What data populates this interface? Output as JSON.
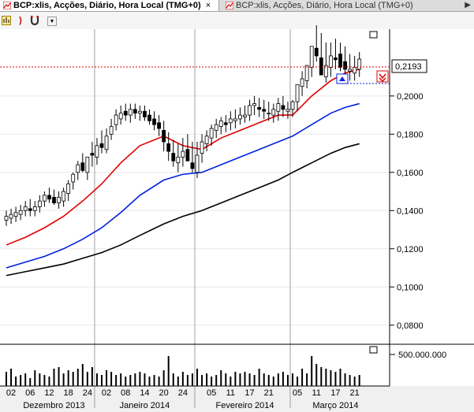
{
  "tabs": [
    {
      "label": "BCP:xlis, Acções, Diário, Hora Local (TMG+0)",
      "close": "×",
      "active": true,
      "icon": "chart-icon"
    },
    {
      "label": "BCP:xlis, Acções, Diário, Hora Local (TMG+0)",
      "active": false,
      "icon": "chart-icon"
    }
  ],
  "toolbar": {
    "icons": [
      "chart-icon",
      "undo-icon",
      "magnet-icon",
      "dropdown-icon"
    ]
  },
  "price_panel": {
    "last_price_label": "0,2193"
  },
  "volume_panel": {
    "scale_label": "500.000.000"
  },
  "colors": {
    "bull": "#ffffff",
    "bear": "#000000",
    "ma_fast": "#e00000",
    "ma_mid": "#0022dd",
    "ma_slow": "#000000",
    "last_price_line": "#e00000",
    "grid": "#a0a0a0"
  },
  "chart_data": [
    {
      "type": "candlestick",
      "title": "BCP:xlis, Acções, Diário, Hora Local (TMG+0)",
      "xlabel": "",
      "ylabel": "",
      "ylim": [
        0.07,
        0.235
      ],
      "y_ticks": [
        "0,2000",
        "0,1800",
        "0,1600",
        "0,1400",
        "0,1200",
        "0,1000",
        "0,0800"
      ],
      "y_tick_values": [
        0.2,
        0.18,
        0.16,
        0.14,
        0.12,
        0.1,
        0.08
      ],
      "x_tick_labels": [
        "02",
        "06",
        "12",
        "18",
        "24",
        "02",
        "08",
        "14",
        "20",
        "24",
        "05",
        "11",
        "17",
        "21",
        "05",
        "11",
        "17",
        "21"
      ],
      "x_tick_index": [
        1,
        5,
        9,
        13,
        17,
        21,
        25,
        29,
        33,
        37,
        43,
        47,
        51,
        55,
        61,
        65,
        69,
        73
      ],
      "month_labels": [
        {
          "label": "Dezembro 2013",
          "index": 10
        },
        {
          "label": "Janeiro 2014",
          "index": 29
        },
        {
          "label": "Fevereiro 2014",
          "index": 50
        },
        {
          "label": "Março 2014",
          "index": 69
        }
      ],
      "month_separators": [
        19,
        40,
        60
      ],
      "grid": true,
      "last_price": 0.2193,
      "series": [
        {
          "type": "ohlc",
          "open": [
            0.135,
            0.136,
            0.137,
            0.138,
            0.14,
            0.141,
            0.14,
            0.142,
            0.145,
            0.148,
            0.147,
            0.144,
            0.145,
            0.149,
            0.155,
            0.16,
            0.165,
            0.16,
            0.17,
            0.168,
            0.175,
            0.172,
            0.18,
            0.185,
            0.188,
            0.192,
            0.19,
            0.193,
            0.191,
            0.192,
            0.19,
            0.188,
            0.186,
            0.182,
            0.175,
            0.17,
            0.165,
            0.168,
            0.172,
            0.165,
            0.16,
            0.17,
            0.175,
            0.178,
            0.182,
            0.184,
            0.186,
            0.186,
            0.187,
            0.188,
            0.189,
            0.19,
            0.195,
            0.194,
            0.193,
            0.191,
            0.19,
            0.192,
            0.195,
            0.192,
            0.193,
            0.197,
            0.205,
            0.208,
            0.215,
            0.225,
            0.22,
            0.21,
            0.215,
            0.22,
            0.222,
            0.218,
            0.213,
            0.212,
            0.214
          ],
          "high": [
            0.14,
            0.141,
            0.142,
            0.143,
            0.145,
            0.146,
            0.145,
            0.148,
            0.15,
            0.152,
            0.151,
            0.15,
            0.152,
            0.156,
            0.16,
            0.166,
            0.17,
            0.168,
            0.176,
            0.178,
            0.182,
            0.183,
            0.188,
            0.193,
            0.195,
            0.196,
            0.196,
            0.196,
            0.195,
            0.195,
            0.193,
            0.192,
            0.19,
            0.187,
            0.181,
            0.177,
            0.175,
            0.178,
            0.18,
            0.176,
            0.176,
            0.18,
            0.182,
            0.185,
            0.188,
            0.189,
            0.19,
            0.192,
            0.193,
            0.194,
            0.195,
            0.198,
            0.2,
            0.199,
            0.198,
            0.197,
            0.196,
            0.199,
            0.2,
            0.197,
            0.198,
            0.202,
            0.213,
            0.216,
            0.223,
            0.237,
            0.233,
            0.228,
            0.228,
            0.23,
            0.228,
            0.226,
            0.222,
            0.221,
            0.223
          ],
          "low": [
            0.132,
            0.133,
            0.134,
            0.135,
            0.137,
            0.137,
            0.137,
            0.139,
            0.142,
            0.144,
            0.143,
            0.141,
            0.142,
            0.145,
            0.151,
            0.156,
            0.16,
            0.156,
            0.163,
            0.164,
            0.17,
            0.17,
            0.177,
            0.182,
            0.185,
            0.187,
            0.186,
            0.188,
            0.187,
            0.187,
            0.185,
            0.182,
            0.179,
            0.171,
            0.166,
            0.163,
            0.16,
            0.163,
            0.166,
            0.16,
            0.157,
            0.165,
            0.171,
            0.174,
            0.178,
            0.18,
            0.181,
            0.182,
            0.183,
            0.185,
            0.186,
            0.187,
            0.19,
            0.189,
            0.188,
            0.187,
            0.186,
            0.187,
            0.189,
            0.188,
            0.189,
            0.192,
            0.2,
            0.204,
            0.21,
            0.218,
            0.212,
            0.207,
            0.21,
            0.214,
            0.213,
            0.211,
            0.208,
            0.208,
            0.21
          ],
          "close": [
            0.137,
            0.138,
            0.139,
            0.14,
            0.142,
            0.14,
            0.142,
            0.145,
            0.148,
            0.146,
            0.144,
            0.147,
            0.15,
            0.154,
            0.159,
            0.164,
            0.161,
            0.168,
            0.169,
            0.174,
            0.173,
            0.179,
            0.184,
            0.19,
            0.191,
            0.19,
            0.193,
            0.191,
            0.192,
            0.189,
            0.187,
            0.185,
            0.183,
            0.176,
            0.171,
            0.166,
            0.168,
            0.171,
            0.166,
            0.162,
            0.169,
            0.176,
            0.179,
            0.183,
            0.185,
            0.187,
            0.185,
            0.188,
            0.188,
            0.19,
            0.19,
            0.195,
            0.196,
            0.193,
            0.192,
            0.191,
            0.193,
            0.196,
            0.193,
            0.193,
            0.197,
            0.206,
            0.209,
            0.216,
            0.226,
            0.221,
            0.211,
            0.216,
            0.221,
            0.219,
            0.215,
            0.214,
            0.214,
            0.215,
            0.2193
          ]
        },
        {
          "name": "",
          "type": "line",
          "color": "#e00000",
          "x": [
            0,
            4,
            8,
            12,
            16,
            20,
            24,
            28,
            33,
            37,
            41,
            45,
            49,
            53,
            57,
            60,
            64,
            68,
            71,
            74
          ],
          "values": [
            0.122,
            0.126,
            0.131,
            0.137,
            0.145,
            0.154,
            0.165,
            0.174,
            0.179,
            0.174,
            0.172,
            0.178,
            0.182,
            0.186,
            0.19,
            0.19,
            0.2,
            0.208,
            0.212,
            0.214
          ]
        },
        {
          "name": "",
          "type": "line",
          "color": "#0022dd",
          "x": [
            0,
            4,
            8,
            12,
            16,
            20,
            24,
            28,
            33,
            37,
            41,
            45,
            49,
            53,
            57,
            60,
            64,
            68,
            71,
            74
          ],
          "values": [
            0.11,
            0.113,
            0.116,
            0.12,
            0.125,
            0.131,
            0.139,
            0.148,
            0.156,
            0.159,
            0.16,
            0.164,
            0.168,
            0.172,
            0.176,
            0.179,
            0.185,
            0.191,
            0.194,
            0.196
          ]
        },
        {
          "name": "",
          "type": "line",
          "color": "#000000",
          "x": [
            0,
            4,
            8,
            12,
            16,
            20,
            24,
            28,
            33,
            37,
            41,
            45,
            49,
            53,
            57,
            60,
            64,
            68,
            71,
            74
          ],
          "values": [
            0.106,
            0.108,
            0.11,
            0.112,
            0.115,
            0.118,
            0.122,
            0.127,
            0.133,
            0.137,
            0.14,
            0.144,
            0.148,
            0.152,
            0.156,
            0.16,
            0.165,
            0.17,
            0.173,
            0.175
          ]
        }
      ]
    },
    {
      "type": "bar",
      "title": "",
      "xlabel": "",
      "ylabel": "",
      "ylim": [
        0,
        500000000
      ],
      "values": [
        0.45,
        0.55,
        0.3,
        0.35,
        0.4,
        0.25,
        0.5,
        0.4,
        0.35,
        0.3,
        0.55,
        0.6,
        0.4,
        0.5,
        0.45,
        0.55,
        0.7,
        0.45,
        0.6,
        0.4,
        0.35,
        0.5,
        0.45,
        0.35,
        0.4,
        0.3,
        0.35,
        0.4,
        0.45,
        0.4,
        0.3,
        0.35,
        0.3,
        0.5,
        0.95,
        0.4,
        0.3,
        0.45,
        0.35,
        0.4,
        0.55,
        0.35,
        0.4,
        0.3,
        0.35,
        0.5,
        0.4,
        0.3,
        0.45,
        0.4,
        0.45,
        0.4,
        0.35,
        0.55,
        0.4,
        0.35,
        0.3,
        0.4,
        0.45,
        0.35,
        0.4,
        0.3,
        0.55,
        0.4,
        0.95,
        0.7,
        0.6,
        0.55,
        0.5,
        0.45,
        0.55,
        0.4,
        0.35,
        0.3,
        0.35
      ]
    }
  ]
}
